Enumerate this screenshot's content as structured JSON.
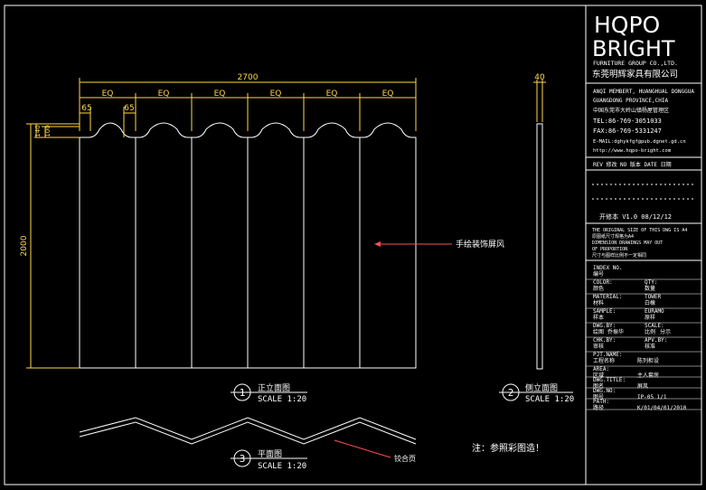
{
  "colors": {
    "background": "#000000",
    "outline": "#ffffff",
    "dimension": "#ffd84a",
    "leader": "#ff5050"
  },
  "logo": {
    "line1": "HQPO",
    "line2": "BRIGHT",
    "sub": "FURNITURE GROUP CO.,LTD.",
    "cn": "东莞明辉家具有限公司"
  },
  "company": {
    "addr1": "ANQI MEMBERT, HUANGHUAL DONGGUA",
    "addr2": "GUANGDONG PROVINCE,CHIA",
    "addr_cn": "中国东莞市大岭山镇杨屋管理区",
    "tel": "TEL:86-769-3051033",
    "fax": "FAX:86-769-5331247",
    "email": "E-MAIL:dghykfgf@pub.dgnet.gd.cn",
    "web": "http://www.hqpo-bright.com"
  },
  "revision": {
    "header": "REV 修改  NO 版本  DATE 日期",
    "row": "开修本    V1.0    08/12/12"
  },
  "notes": [
    "THE ORIGINAL SIZE OF THIS DWG IS A4",
    "原图纸尺寸规格为A4",
    "DIMENSION DRAWINGS MAY OUT",
    "OF PROPORTION",
    "尺寸与图样比例不一定相同"
  ],
  "fields": [
    {
      "en": "INDEX NO.",
      "cn": "编号",
      "val": ""
    },
    {
      "en": "COLOR:",
      "cn": "颜色",
      "en2": "QTY:",
      "cn2": "数量"
    },
    {
      "en": "MATERIAL:",
      "cn": "材料",
      "en2": "TOWER",
      "cn2": "白橡"
    },
    {
      "en": "SAMPLE:",
      "cn": "样本",
      "en2": "EURAMO",
      "cn2": "原样"
    },
    {
      "en": "DWG.BY:",
      "cn": "绘图",
      "mid": "乔振华",
      "en2": "SCALE:",
      "cn2": "比例",
      "val2": "分示"
    },
    {
      "en": "CHK.BY:",
      "cn": "审核",
      "en2": "APV.BY:",
      "cn2": "核准"
    },
    {
      "en": "PJT.NAME:",
      "cn": "工程名称",
      "val": "陈列柜设"
    },
    {
      "en": "AREA:",
      "cn": "区域",
      "val": "主人套房"
    },
    {
      "en": "DWG.TITLE:",
      "cn": "图名",
      "val": "屏风"
    },
    {
      "en": "DWG.NO:",
      "cn": "图号",
      "val": "IP-05   1/1"
    },
    {
      "en": "PATH:",
      "cn": "路径",
      "val": "K/01/04/01/2010"
    }
  ],
  "drawing": {
    "overall_width": "2700",
    "eq_label": "EQ",
    "eq_count": 6,
    "dim_65a": "65",
    "dim_65b": "65",
    "dim_140": "140",
    "dim_100": "100",
    "height": "2000",
    "side_thickness": "40",
    "callout": "手绘装饰屏风",
    "fold_label": "铰合页",
    "note": "注：参照彩图造！"
  },
  "views": [
    {
      "num": "1",
      "title": "正立面图",
      "scale": "SCALE 1:20"
    },
    {
      "num": "2",
      "title": "侧立面图",
      "scale": "SCALE 1:20"
    },
    {
      "num": "3",
      "title": "平面图",
      "scale": "SCALE 1:20"
    }
  ]
}
